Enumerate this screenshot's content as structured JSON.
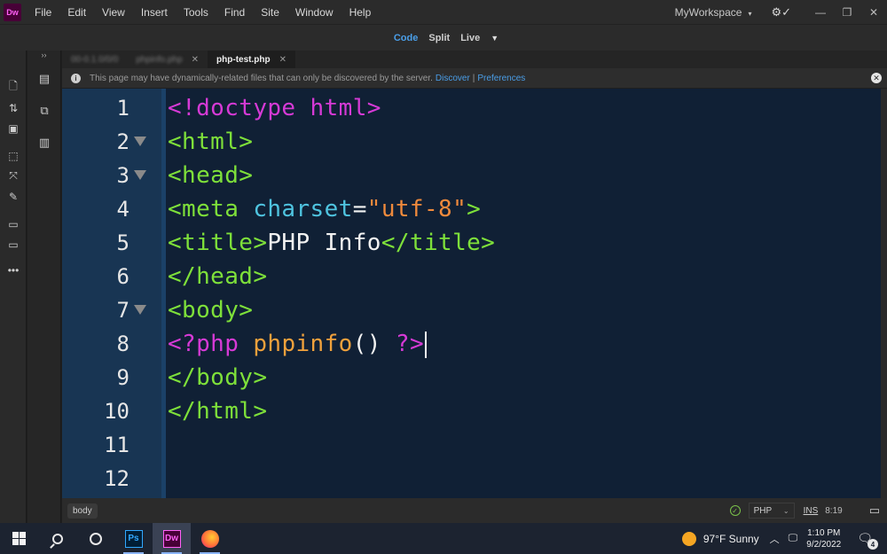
{
  "app": {
    "logo": "Dw",
    "menu": [
      "File",
      "Edit",
      "View",
      "Insert",
      "Tools",
      "Find",
      "Site",
      "Window",
      "Help"
    ],
    "workspace": "MyWorkspace",
    "window_controls": [
      "minimize-icon",
      "restore-icon",
      "close-icon"
    ]
  },
  "view_switcher": {
    "code": "Code",
    "split": "Split",
    "live": "Live"
  },
  "tabs": [
    {
      "label": "00-0.1.0/0/0",
      "active": false
    },
    {
      "label": "phpinfo.php",
      "active": false
    },
    {
      "label": "php-test.php",
      "active": true
    }
  ],
  "infobar": {
    "message": "This page may have dynamically-related files that can only be discovered by the server.",
    "discover_link": "Discover",
    "separator": "|",
    "preferences_link": "Preferences"
  },
  "editor": {
    "line_numbers": [
      "1",
      "2",
      "3",
      "4",
      "5",
      "6",
      "7",
      "8",
      "9",
      "10",
      "11",
      "12"
    ],
    "fold_lines": [
      2,
      3,
      7
    ],
    "code": {
      "l1": "<!doctype html>",
      "l2": "<html>",
      "l3": "<head>",
      "l4_open": "<meta ",
      "l4_attr": "charset",
      "l4_eq": "=",
      "l4_val": "\"utf-8\"",
      "l4_close": ">",
      "l5_open": "<title>",
      "l5_text": "PHP Info",
      "l5_close": "</title>",
      "l6": "</head>",
      "l7": "<body>",
      "l8_open": "<?php",
      "l8_func": " phpinfo",
      "l8_parens": "() ",
      "l8_close": "?>",
      "l9": "</body>",
      "l10": "</html>"
    },
    "colors": {
      "tag": "#7ee03a",
      "php": "#d63ad6",
      "attribute": "#4fc4e0",
      "string": "#f08a3c",
      "function": "#f0a13c",
      "background": "#102035",
      "gutter": "#183553"
    }
  },
  "statusbar": {
    "tag": "body",
    "language": "PHP",
    "mode": "INS",
    "cursor": "8:19"
  },
  "taskbar": {
    "apps": [
      "start-icon",
      "search-icon",
      "cortana-icon",
      "photoshop-icon",
      "dreamweaver-icon",
      "firefox-icon"
    ],
    "ps_label": "Ps",
    "dw_label": "Dw",
    "weather": "97°F  Sunny",
    "time": "1:10 PM",
    "date": "9/2/2022",
    "notifications": "4"
  }
}
